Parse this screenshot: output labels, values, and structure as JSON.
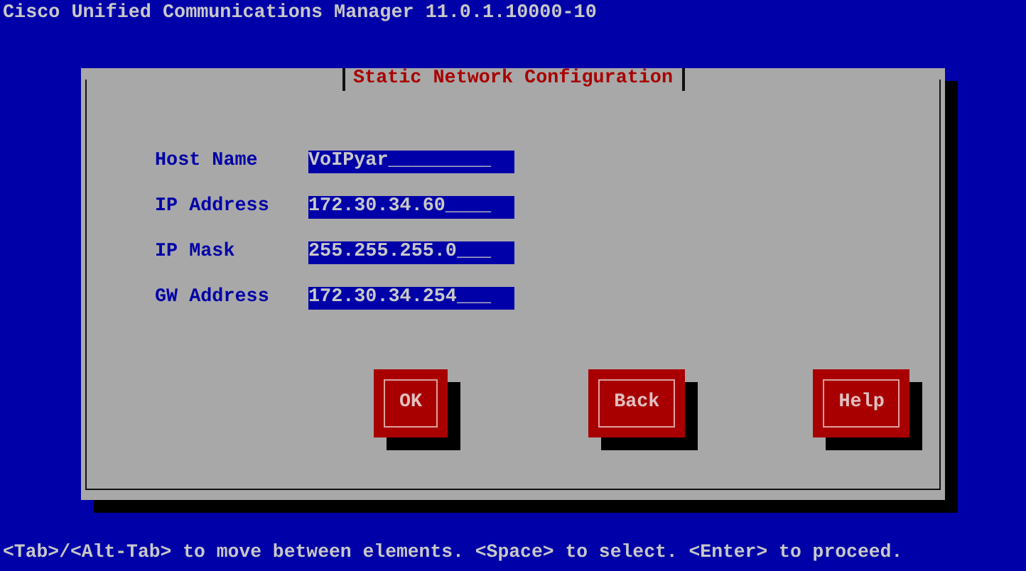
{
  "window": {
    "title": "Cisco Unified Communications Manager 11.0.1.10000-10"
  },
  "dialog": {
    "title": "Static Network Configuration",
    "fields": [
      {
        "label": "Host Name",
        "value": "VoIPyar_________"
      },
      {
        "label": "IP Address",
        "value": "172.30.34.60____"
      },
      {
        "label": "IP Mask",
        "value": "255.255.255.0___"
      },
      {
        "label": "GW Address",
        "value": "172.30.34.254___"
      }
    ],
    "buttons": [
      "OK",
      "Back",
      "Help"
    ]
  },
  "status_bar": "<Tab>/<Alt-Tab> to move between elements. <Space> to select. <Enter> to proceed."
}
